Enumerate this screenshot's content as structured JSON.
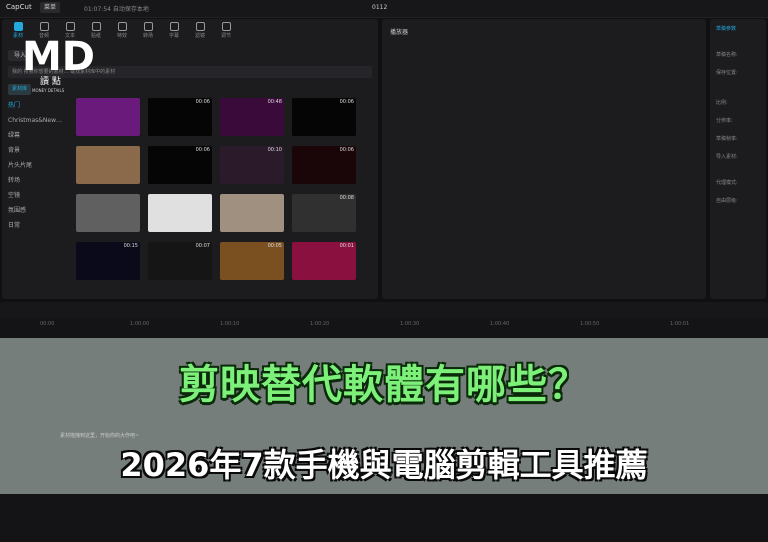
{
  "app": {
    "name": "CapCut",
    "menu_label": "菜单",
    "save_status": "01:07:54 自动保存本地",
    "project_name": "0112"
  },
  "tools": [
    {
      "label": "素材",
      "active": true
    },
    {
      "label": "音频",
      "active": false
    },
    {
      "label": "文本",
      "active": false
    },
    {
      "label": "贴纸",
      "active": false
    },
    {
      "label": "特效",
      "active": false
    },
    {
      "label": "转场",
      "active": false
    },
    {
      "label": "字幕",
      "active": false
    },
    {
      "label": "滤镜",
      "active": false
    },
    {
      "label": "调节",
      "active": false
    }
  ],
  "import_label": "导入",
  "search_placeholder": "我的 搜索你想要的素材… 或找素材库中的素材",
  "category_tab": "素材库",
  "categories": [
    "热门",
    "Christmas&New…",
    "绿幕",
    "背景",
    "片头片尾",
    "转场",
    "空镜",
    "氛围感",
    "日常"
  ],
  "thumbnails": [
    {
      "dur": "",
      "color": "#6a1a7a"
    },
    {
      "dur": "00:06",
      "color": "#050505"
    },
    {
      "dur": "00:48",
      "color": "#3a0a3a"
    },
    {
      "dur": "00:06",
      "color": "#050505"
    },
    {
      "dur": "",
      "color": "#8a6a4a"
    },
    {
      "dur": "00:06",
      "color": "#050505"
    },
    {
      "dur": "00:10",
      "color": "#2a1a2a"
    },
    {
      "dur": "00:06",
      "color": "#1a0508"
    },
    {
      "dur": "",
      "color": "#606060"
    },
    {
      "dur": "",
      "color": "#e0e0e0"
    },
    {
      "dur": "",
      "color": "#a09080"
    },
    {
      "dur": "00:08",
      "color": "#303030"
    },
    {
      "dur": "00:15",
      "color": "#0a0a1a"
    },
    {
      "dur": "00:07",
      "color": "#151515"
    },
    {
      "dur": "00:05",
      "color": "#7a5020"
    },
    {
      "dur": "00:01",
      "color": "#8a1040"
    }
  ],
  "player_title": "播放器",
  "right_panel": [
    "草稿参数",
    "草稿名称:",
    "保存位置:",
    "比例:",
    "分辨率:",
    "草稿帧率:",
    "导入素材:",
    "代理模式:",
    "自由层级:"
  ],
  "hint_text": "素材拖拽到这里，开始你的大作吧~",
  "ruler_ticks": [
    "00:00",
    "1:00:00",
    "1:00:10",
    "1:00:20",
    "1:00:30",
    "1:00:40",
    "1:00:50",
    "1:00:01"
  ],
  "watermark": {
    "letters": "MD",
    "sub": "讀 點",
    "tiny": "MONEY DETAILS"
  },
  "headline": "剪映替代軟體有哪些？",
  "subheadline": "2026年7款手機與電腦剪輯工具推薦"
}
